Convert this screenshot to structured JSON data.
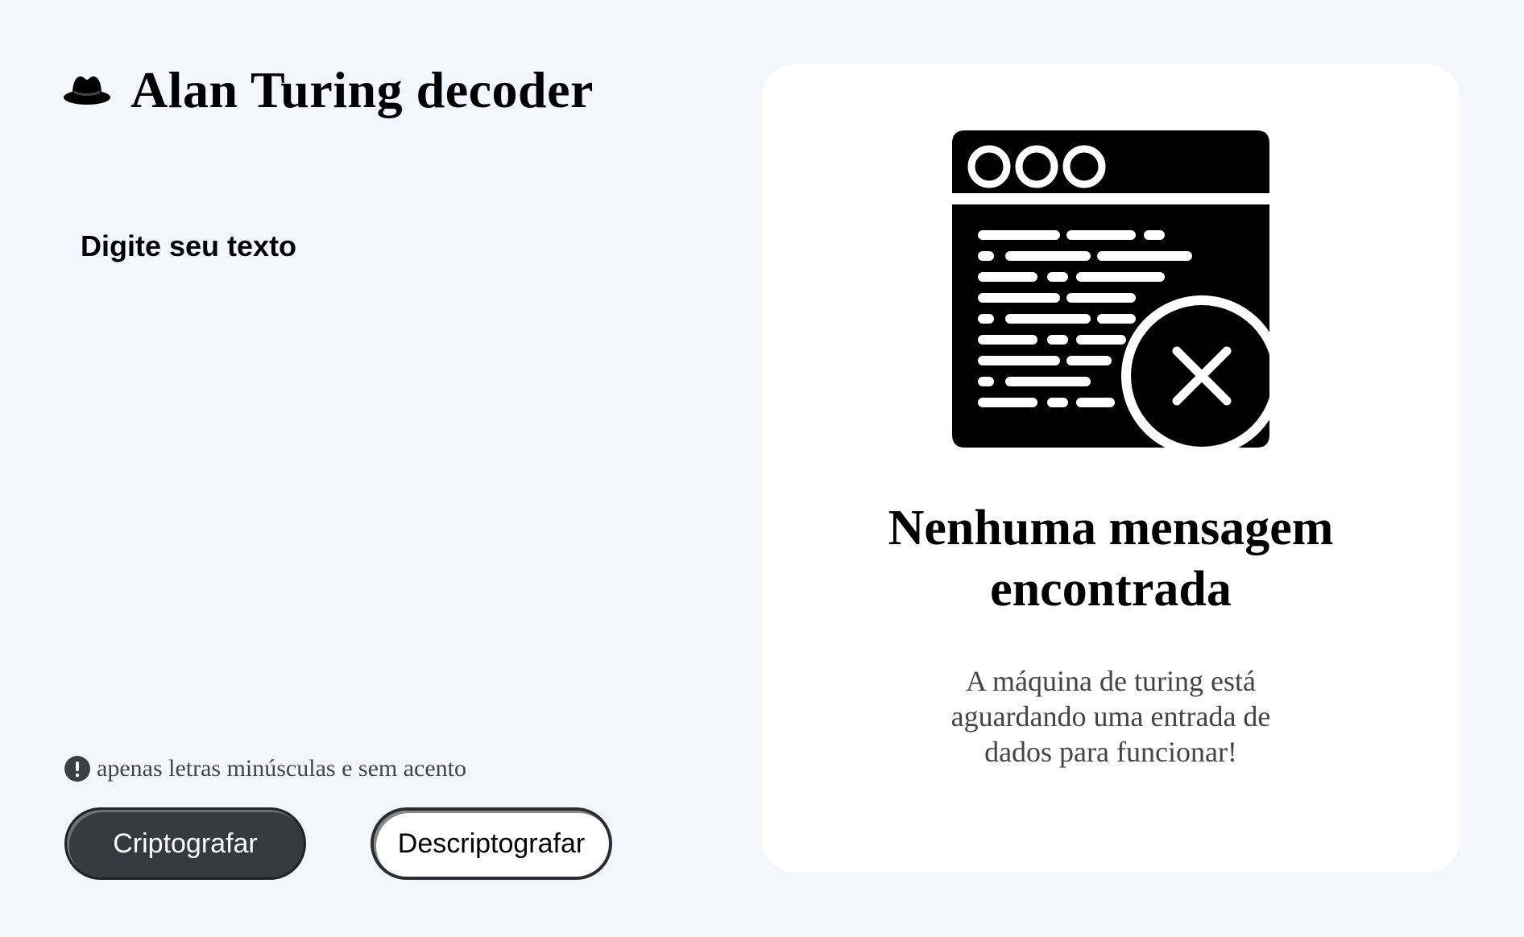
{
  "header": {
    "title": "Alan Turing decoder",
    "logo_icon": "hat-icon"
  },
  "input": {
    "placeholder": "Digite seu texto",
    "value": ""
  },
  "hint": {
    "icon": "exclamation-circle-icon",
    "text": "apenas letras minúsculas e sem acento"
  },
  "buttons": {
    "encrypt_label": "Criptografar",
    "decrypt_label": "Descriptografar"
  },
  "result": {
    "illustration_icon": "document-error-icon",
    "title_lines": [
      "Nenhuma mensagem",
      "encontrada"
    ],
    "description_lines": [
      "A máquina de turing está",
      "aguardando uma entrada de",
      "dados para funcionar!"
    ]
  },
  "colors": {
    "background": "#f3f6fc",
    "card": "#ffffff",
    "primary_button": "#343a40",
    "text_muted": "#444444"
  }
}
